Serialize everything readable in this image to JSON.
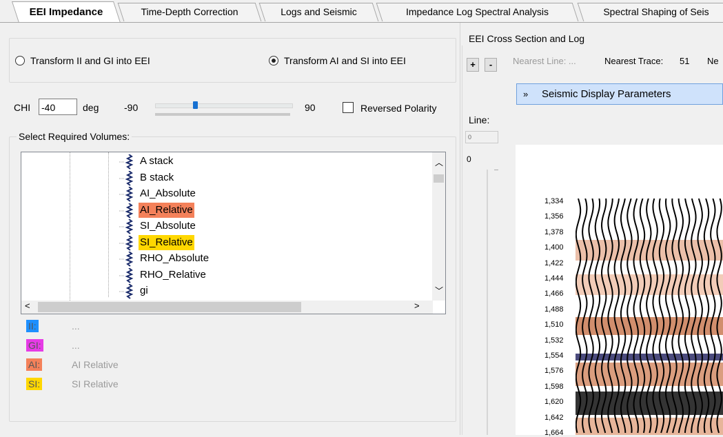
{
  "tabs": [
    {
      "label": "EEI Impedance",
      "active": true
    },
    {
      "label": "Time-Depth Correction"
    },
    {
      "label": "Logs and Seismic"
    },
    {
      "label": "Impedance Log Spectral Analysis"
    },
    {
      "label": "Spectral Shaping of Seis"
    }
  ],
  "transform": {
    "option1": "Transform II and GI into EEI",
    "option2": "Transform AI and SI into EEI",
    "selected": 2
  },
  "chi": {
    "label": "CHI",
    "value": "-40",
    "unit": "deg",
    "min": "-90",
    "max": "90",
    "slider_position_fraction": 0.28
  },
  "reversed_polarity": {
    "label": "Reversed Polarity",
    "checked": false
  },
  "volumes": {
    "title": "Select Required Volumes:",
    "items": [
      {
        "label": "A stack"
      },
      {
        "label": "B stack"
      },
      {
        "label": "AI_Absolute"
      },
      {
        "label": "AI_Relative",
        "highlight": "#f4815a"
      },
      {
        "label": "SI_Absolute"
      },
      {
        "label": "SI_Relative",
        "highlight": "#ffd700"
      },
      {
        "label": "RHO_Absolute"
      },
      {
        "label": "RHO_Relative"
      },
      {
        "label": "gi"
      }
    ]
  },
  "legend": [
    {
      "tag": "II:",
      "color": "#1e90ff",
      "value": "..."
    },
    {
      "tag": "GI:",
      "color": "#e63be6",
      "value": "..."
    },
    {
      "tag": "AI:",
      "color": "#f4815a",
      "value": "AI  Relative"
    },
    {
      "tag": "SI:",
      "color": "#ffd700",
      "value": "SI  Relative"
    }
  ],
  "right": {
    "group_title": "EEI Cross Section and Log",
    "plus": "+",
    "minus": "-",
    "nearest_line": "Nearest Line:  ...",
    "nearest_trace_label": "Nearest Trace:",
    "nearest_trace_value": "51",
    "nearest_cut": "Ne",
    "seis_button": "Seismic Display Parameters",
    "line_label": "Line:",
    "line_value": "0",
    "zero": "0",
    "y_ticks": [
      "1,334",
      "1,356",
      "1,378",
      "1,400",
      "1,422",
      "1,444",
      "1,466",
      "1,488",
      "1,510",
      "1,532",
      "1,554",
      "1,576",
      "1,598",
      "1,620",
      "1,642",
      "1,664"
    ]
  }
}
